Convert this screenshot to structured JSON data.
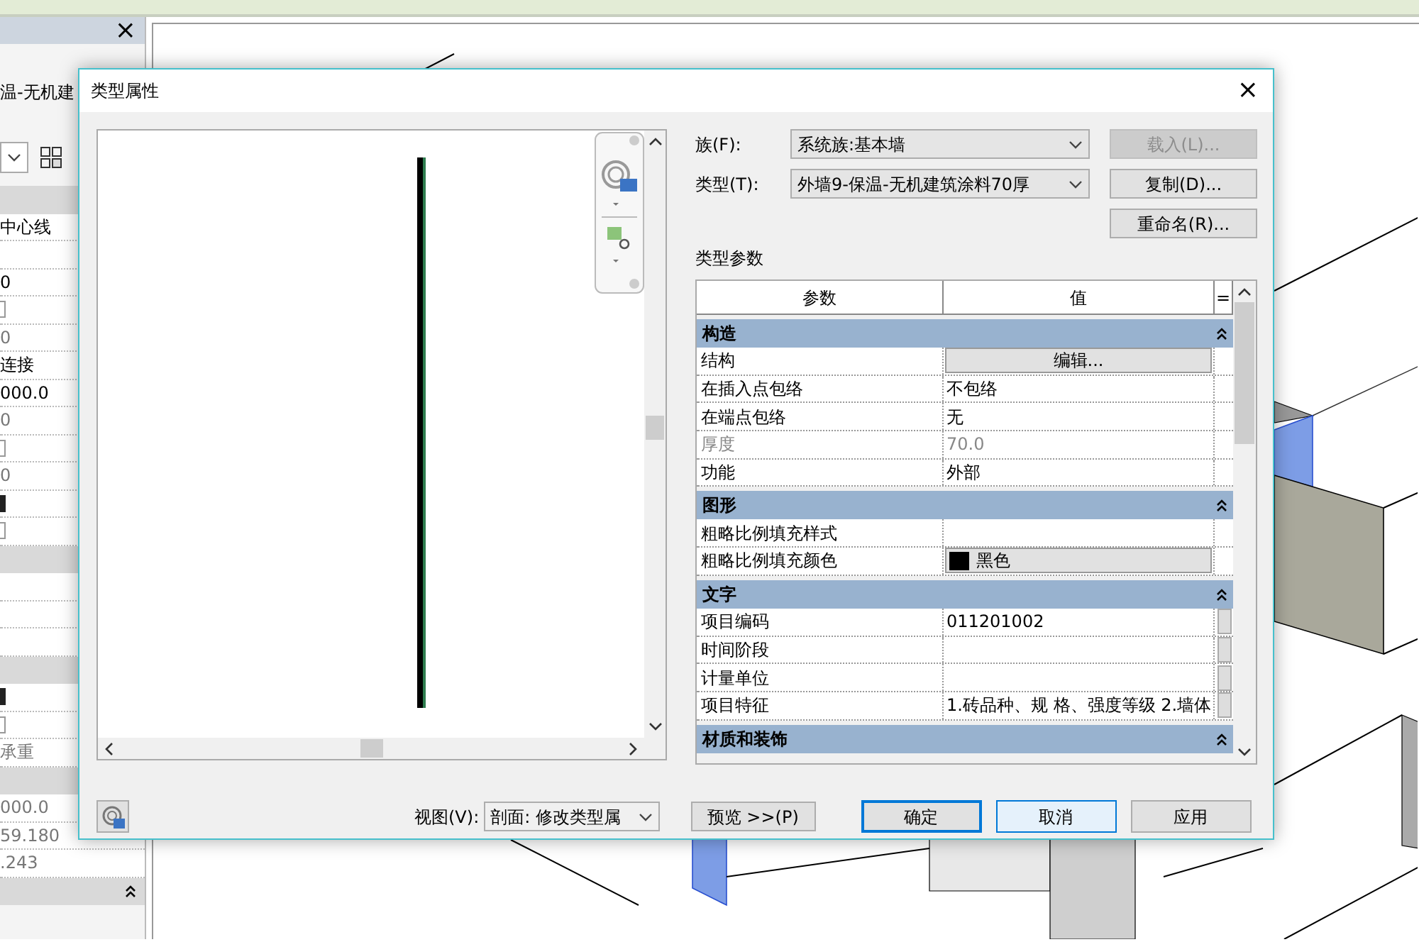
{
  "properties_panel": {
    "close": "×",
    "type_name": "温-无机建",
    "rows": [
      {
        "kind": "header"
      },
      {
        "kind": "text",
        "text": "中心线",
        "muted": false
      },
      {
        "kind": "empty"
      },
      {
        "kind": "text",
        "text": "0",
        "muted": false
      },
      {
        "kind": "checkbox",
        "checked": false
      },
      {
        "kind": "text",
        "text": "0",
        "muted": true
      },
      {
        "kind": "text",
        "text": "连接",
        "muted": false
      },
      {
        "kind": "text",
        "text": "000.0",
        "muted": false
      },
      {
        "kind": "text",
        "text": "0",
        "muted": true
      },
      {
        "kind": "checkbox",
        "checked": false
      },
      {
        "kind": "text",
        "text": "0",
        "muted": true
      },
      {
        "kind": "checkbox",
        "checked": true
      },
      {
        "kind": "checkbox",
        "checked": false
      },
      {
        "kind": "header"
      },
      {
        "kind": "empty"
      },
      {
        "kind": "empty"
      },
      {
        "kind": "empty"
      },
      {
        "kind": "header"
      },
      {
        "kind": "checkbox",
        "checked": true
      },
      {
        "kind": "checkbox",
        "checked": false
      },
      {
        "kind": "text",
        "text": "承重",
        "muted": true
      },
      {
        "kind": "header"
      },
      {
        "kind": "text",
        "text": "000.0",
        "muted": true
      },
      {
        "kind": "text",
        "text": "59.180",
        "muted": true
      },
      {
        "kind": "text",
        "text": ".243",
        "muted": true
      },
      {
        "kind": "header",
        "expanded": true
      }
    ]
  },
  "dialog": {
    "title": "类型属性",
    "close": "×",
    "family": {
      "label": "族(F):",
      "value": "系统族:基本墙"
    },
    "type": {
      "label": "类型(T):",
      "value": "外墙9-保温-无机建筑涂料70厚"
    },
    "buttons": [
      {
        "label": "载入(L)...",
        "disabled": true
      },
      {
        "label": "复制(D)...",
        "disabled": false
      },
      {
        "label": "重命名(R)...",
        "disabled": false
      }
    ],
    "params_title": "类型参数",
    "columns": [
      "参数",
      "值",
      "="
    ],
    "groups": [
      {
        "name": "构造",
        "expanded": true,
        "rows": [
          {
            "name": "结构",
            "value": "编辑...",
            "kind": "button",
            "disabled": false,
            "browse": false
          },
          {
            "name": "在插入点包络",
            "value": "不包络",
            "kind": "text",
            "disabled": false,
            "browse": false
          },
          {
            "name": "在端点包络",
            "value": "无",
            "kind": "text",
            "disabled": false,
            "browse": false
          },
          {
            "name": "厚度",
            "value": "70.0",
            "kind": "text",
            "disabled": true,
            "browse": false
          },
          {
            "name": "功能",
            "value": "外部",
            "kind": "text",
            "disabled": false,
            "browse": false
          }
        ]
      },
      {
        "name": "图形",
        "expanded": true,
        "rows": [
          {
            "name": "粗略比例填充样式",
            "kind": "text",
            "disabled": false,
            "browse": false
          },
          {
            "name": "粗略比例填充颜色",
            "value": "黑色",
            "kind": "color",
            "color": "#000000",
            "disabled": false,
            "browse": false
          }
        ]
      },
      {
        "name": "文字",
        "expanded": true,
        "rows": [
          {
            "name": "项目编码",
            "value": "011201002",
            "kind": "text",
            "disabled": false,
            "browse": true
          },
          {
            "name": "时间阶段",
            "kind": "text",
            "disabled": false,
            "browse": true
          },
          {
            "name": "计量单位",
            "kind": "text",
            "disabled": false,
            "browse": true
          },
          {
            "name": "项目特征",
            "value": "1.砖品种、规 格、强度等级 2.墙体",
            "kind": "text",
            "disabled": false,
            "browse": true
          }
        ]
      },
      {
        "name": "材质和装饰",
        "expanded": true
      }
    ],
    "view": {
      "label": "视图(V):",
      "value": "剖面: 修改类型属"
    },
    "preview_button": "预览 >>(P)",
    "actions": [
      {
        "label": "确定",
        "kind": "default"
      },
      {
        "label": "取消",
        "kind": "hover"
      },
      {
        "label": "应用",
        "kind": "normal"
      }
    ]
  }
}
